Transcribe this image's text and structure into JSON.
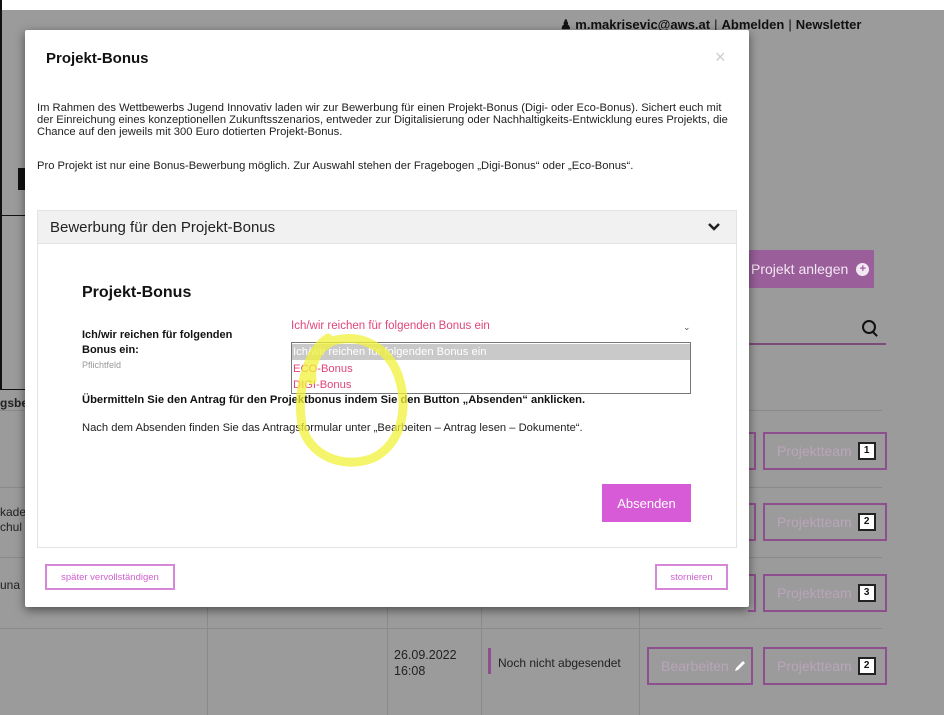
{
  "header": {
    "user_email": "m.makrisevic@aws.at",
    "logout_label": "Abmelden",
    "newsletter_label": "Newsletter",
    "separator": "|"
  },
  "background": {
    "new_project_label": "Projekt anlegen",
    "rows": [
      {
        "team_label": "Projektteam",
        "team_count": "1"
      },
      {
        "team_label": "Projektteam",
        "team_count": "2"
      },
      {
        "team_label": "Projektteam",
        "team_count": "3"
      },
      {
        "team_label": "Projektteam",
        "team_count": "2"
      }
    ],
    "left_fragments": [
      "gsbe",
      "kade",
      "chul",
      "una"
    ],
    "last_row": {
      "date": "26.09.2022",
      "time": "16:08",
      "status": "Noch nicht abgesendet",
      "edit_label": "Bearbeiten"
    }
  },
  "modal": {
    "title": "Projekt-Bonus",
    "close_symbol": "×",
    "intro_text": "Im Rahmen des Wettbewerbs Jugend Innovativ laden wir zur Bewerbung für einen Projekt-Bonus (Digi- oder Eco-Bonus). Sichert euch mit der Einreichung eines konzeptionellen Zukunftsszenarios, entweder zur Digitalisierung oder Nachhaltigkeits-Entwicklung eures Projekts, die Chance auf den jeweils mit 300 Euro dotierten Projekt-Bonus.",
    "intro_text_2": "Pro Projekt ist nur eine Bonus-Bewerbung möglich. Zur Auswahl stehen der Fragebogen „Digi-Bonus“ oder „Eco-Bonus“.",
    "accordion_title": "Bewerbung für den Projekt-Bonus",
    "section_heading": "Projekt-Bonus",
    "field_label": "Ich/wir reichen für folgenden Bonus ein:",
    "field_required": "Pflichtfeld",
    "select_value": "Ich/wir reichen für folgenden Bonus ein",
    "options": [
      "Ich/wir reichen für folgenden Bonus ein",
      "ECO-Bonus",
      "DIGI-Bonus"
    ],
    "submit_note": "Übermitteln Sie den Antrag für den Projektbonus indem Sie den Button „Absenden“ anklicken.",
    "after_note": "Nach dem Absenden finden Sie das Antragsformular unter „Bearbeiten – Antrag lesen – Dokumente“.",
    "submit_label": "Absenden",
    "later_label": "später vervollständigen",
    "cancel_label": "stornieren"
  },
  "colors": {
    "accent": "#d75ad7",
    "option_text": "#e0457b",
    "highlight": "#f2f23a"
  }
}
